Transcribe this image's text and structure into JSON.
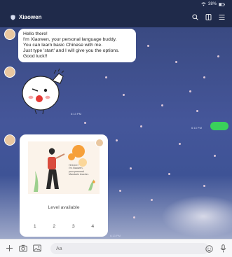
{
  "status_bar": {
    "battery": "38%"
  },
  "header": {
    "title": "Xiaowen"
  },
  "messages": {
    "greeting_lines": [
      "Hello there!",
      "I'm Xiaowen, your personal language buddy.",
      "You can learn basic Chinese with me.",
      "Just type 'start' and I will give you the options.",
      "Good luck!!"
    ],
    "timestamps": [
      "6:13 PM",
      "6:13 PM",
      "6:13 PM"
    ]
  },
  "card": {
    "illustration_text": [
      "Hi there!",
      "I'm Xiaowen,",
      "your personal",
      "Mandarin teacher."
    ],
    "level_label": "Level available",
    "options": [
      "1",
      "2",
      "3",
      "4"
    ]
  },
  "input": {
    "placeholder": "Aa"
  },
  "icons": {
    "header": [
      "search-icon",
      "notes-icon",
      "menu-icon"
    ],
    "input_left": [
      "plus-icon",
      "camera-icon",
      "image-icon"
    ],
    "input_right": [
      "emoji-icon",
      "microphone-icon"
    ]
  },
  "colors": {
    "header_bg": "#1f2a4a",
    "outgoing_bubble": "#3ad15b",
    "chat_bg_top": "#3a4a82"
  }
}
